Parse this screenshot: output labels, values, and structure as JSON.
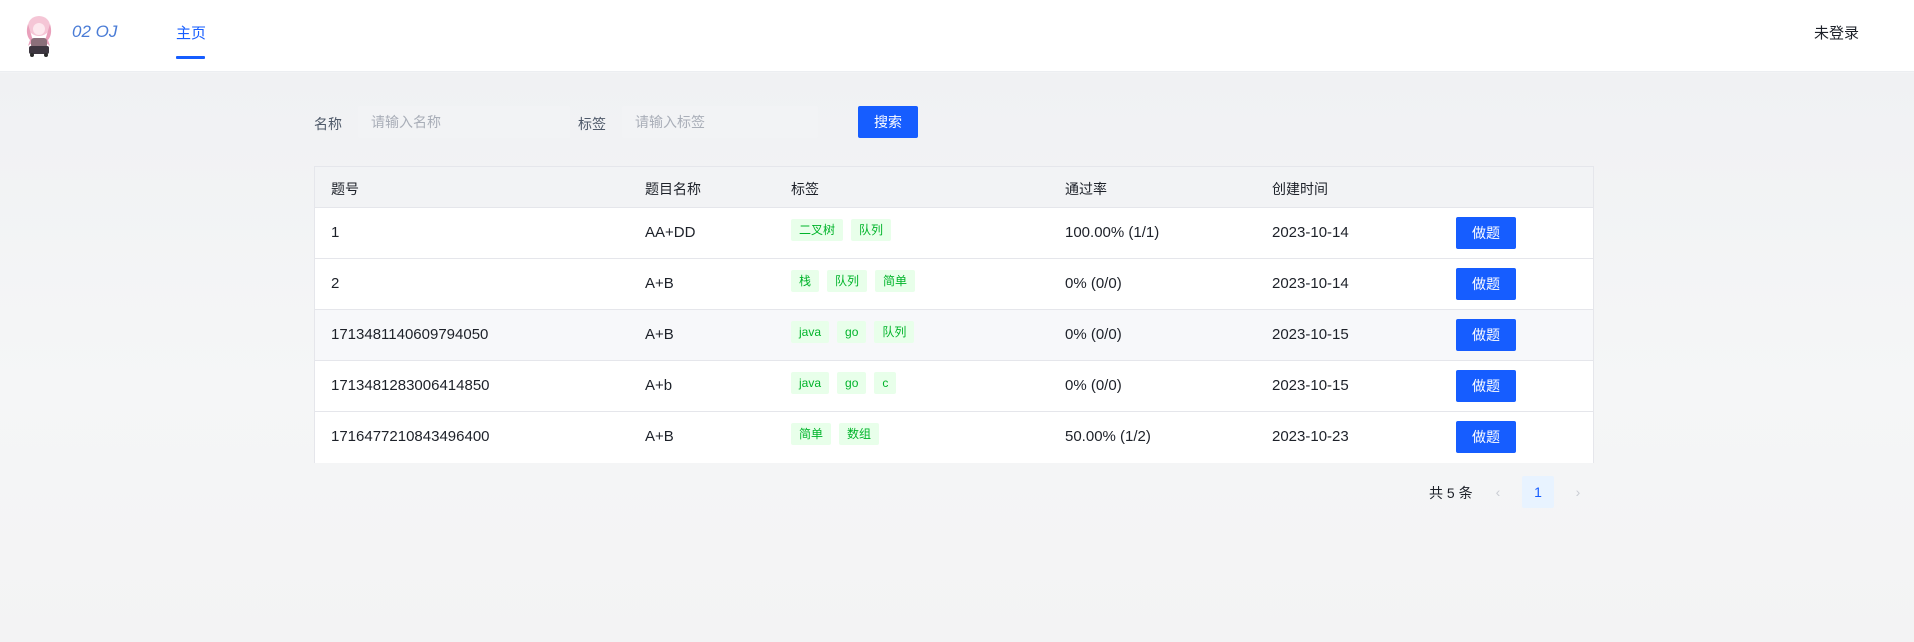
{
  "header": {
    "brand": "02 OJ",
    "nav_home": "主页",
    "login": "未登录"
  },
  "search": {
    "name_label": "名称",
    "name_placeholder": "请输入名称",
    "tag_label": "标签",
    "tag_placeholder": "请输入标签",
    "button": "搜索"
  },
  "table": {
    "columns": [
      "题号",
      "题目名称",
      "标签",
      "通过率",
      "创建时间"
    ],
    "action_label": "做题",
    "rows": [
      {
        "id": "1",
        "title": "AA+DD",
        "tags": [
          "二叉树",
          "队列"
        ],
        "rate": "100.00% (1/1)",
        "created": "2023-10-14"
      },
      {
        "id": "2",
        "title": "A+B",
        "tags": [
          "栈",
          "队列",
          "简单"
        ],
        "rate": "0% (0/0)",
        "created": "2023-10-14"
      },
      {
        "id": "1713481140609794050",
        "title": "A+B",
        "tags": [
          "java",
          "go",
          "队列"
        ],
        "rate": "0% (0/0)",
        "created": "2023-10-15"
      },
      {
        "id": "1713481283006414850",
        "title": "A+b",
        "tags": [
          "java",
          "go",
          "c"
        ],
        "rate": "0% (0/0)",
        "created": "2023-10-15"
      },
      {
        "id": "1716477210843496400",
        "title": "A+B",
        "tags": [
          "简单",
          "数组"
        ],
        "rate": "50.00% (1/2)",
        "created": "2023-10-23"
      }
    ]
  },
  "pagination": {
    "total": "共 5 条",
    "current": "1",
    "prev_icon": "chevron-left-icon",
    "next_icon": "chevron-right-icon"
  },
  "colors": {
    "primary": "#165dff",
    "tag_bg": "#e8ffea",
    "tag_text": "#00b42a"
  }
}
